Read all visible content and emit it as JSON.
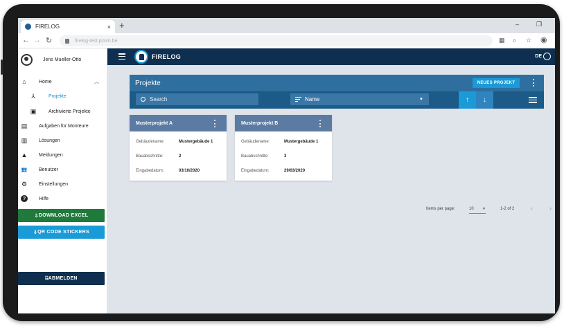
{
  "browser": {
    "tab_title": "FIRELOG",
    "tab_close": "×",
    "new_tab": "+",
    "url": "firelog-test.pcom.be",
    "win_minimize": "–",
    "win_restore": "❐",
    "back": "←",
    "forward": "→",
    "reload": "↻"
  },
  "header": {
    "brand": "FIRELOG",
    "language": "DE"
  },
  "sidebar": {
    "user_name": "Jens Mueller-Otto",
    "items": [
      {
        "label": "Home",
        "icon": "home-icon",
        "glyph": "⌂"
      },
      {
        "label": "Projekte",
        "icon": "sitemap-icon",
        "glyph": "⅄"
      },
      {
        "label": "Archivierte Projekte",
        "icon": "archive-icon",
        "glyph": "▣"
      },
      {
        "label": "Aufgaben für Monteure",
        "icon": "clipboard-icon",
        "glyph": "▤"
      },
      {
        "label": "Lösungen",
        "icon": "book-icon",
        "glyph": "▥"
      },
      {
        "label": "Meldungen",
        "icon": "warning-icon",
        "glyph": "▲"
      },
      {
        "label": "Benutzer",
        "icon": "people-icon",
        "glyph": "👥"
      },
      {
        "label": "Einstellungen",
        "icon": "gear-icon",
        "glyph": "⚙"
      },
      {
        "label": "Hilfe",
        "icon": "help-icon",
        "glyph": "?"
      }
    ],
    "home_chevron": "︿",
    "download_excel": "DOWNLOAD EXCEL",
    "qr_stickers": "QR CODE STICKERS",
    "logout": "ABMELDEN",
    "download_glyph": "⇩",
    "logout_glyph": "⍈"
  },
  "main": {
    "title": "Projekte",
    "new_project": "NEUES PROJEKT",
    "search_placeholder": "Search",
    "sort_field": "Name",
    "sort_dropdown": "▼",
    "up_arrow": "↑",
    "down_arrow": "↓",
    "projects": [
      {
        "name": "Musterprojekt A",
        "building_label": "Gebäudename:",
        "building": "Mustergebäude 1",
        "sections_label": "Bauabschnitte:",
        "sections": "2",
        "date_label": "Eingabedatum:",
        "date": "03/10/2020"
      },
      {
        "name": "Musterprojekt B",
        "building_label": "Gebäudename:",
        "building": "Mustergebäude 1",
        "sections_label": "Bauabschnitte:",
        "sections": "3",
        "date_label": "Eingabedatum:",
        "date": "29/03/2020"
      }
    ],
    "paginator": {
      "items_per_page_label": "Items per page:",
      "items_per_page": "10",
      "caret": "▼",
      "range": "1-2 of 2",
      "prev": "‹",
      "next": "›"
    }
  },
  "colors": {
    "navy": "#0e2f4f",
    "accent": "#1a9ad6",
    "green": "#1f7a3c",
    "card_header": "#5b7ba2"
  }
}
